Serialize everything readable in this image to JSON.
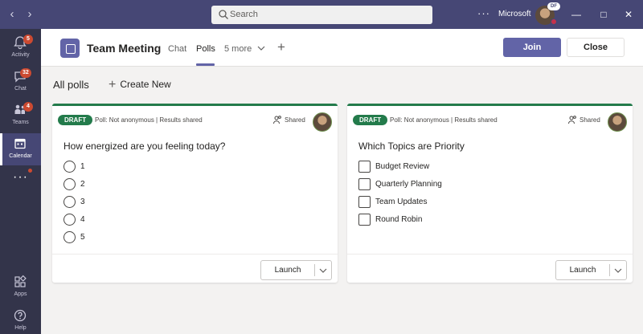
{
  "search": {
    "placeholder": "Search"
  },
  "titlebar": {
    "org": "Microsoft",
    "avatar_badge": "DF"
  },
  "rail": {
    "items": [
      {
        "label": "Activity",
        "badge": "5",
        "icon": "bell-icon"
      },
      {
        "label": "Chat",
        "badge": "32",
        "icon": "chat-icon"
      },
      {
        "label": "Teams",
        "badge": "4",
        "icon": "teams-icon"
      },
      {
        "label": "Calendar",
        "badge": "",
        "icon": "calendar-icon"
      },
      {
        "label": "Apps",
        "badge": "",
        "icon": "apps-icon"
      },
      {
        "label": "Help",
        "badge": "",
        "icon": "help-icon"
      }
    ]
  },
  "header": {
    "title": "Team Meeting",
    "tabs": [
      {
        "label": "Chat"
      },
      {
        "label": "Polls",
        "active": true
      },
      {
        "label": "5 more"
      }
    ],
    "join_label": "Join",
    "close_label": "Close"
  },
  "toolbar": {
    "all_polls": "All polls",
    "create_new": "Create New"
  },
  "cards": [
    {
      "status": "DRAFT",
      "meta": "Poll: Not anonymous | Results shared",
      "shared": "Shared",
      "question": "How energized are you feeling today?",
      "type": "single-choice",
      "options": [
        "1",
        "2",
        "3",
        "4",
        "5"
      ],
      "launch_label": "Launch"
    },
    {
      "status": "DRAFT",
      "meta": "Poll: Not anonymous | Results shared",
      "shared": "Shared",
      "question": "Which Topics are Priority",
      "type": "multiple-choice",
      "options": [
        "Budget Review",
        "Quarterly Planning",
        "Team Updates",
        "Round Robin"
      ],
      "launch_label": "Launch"
    }
  ],
  "colors": {
    "titlebar": "#464775",
    "rail": "#33344a",
    "accent": "#6264a7",
    "draft": "#237b4b",
    "badge": "#cc4a31"
  }
}
